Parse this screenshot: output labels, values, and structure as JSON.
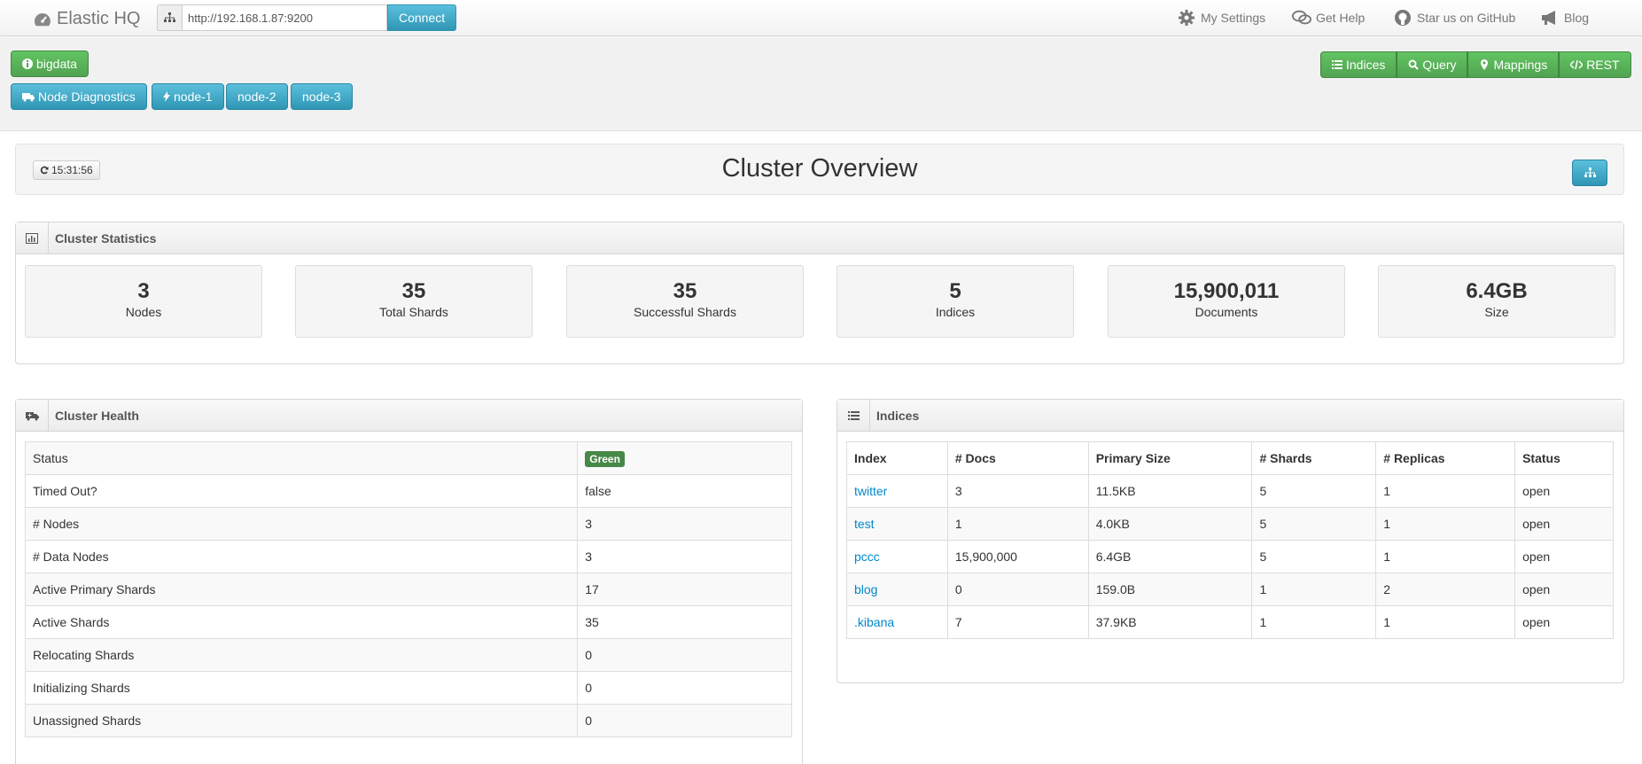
{
  "navbar": {
    "brand": "Elastic HQ",
    "url_value": "http://192.168.1.87:9200",
    "connect_label": "Connect",
    "links": [
      {
        "label": "My Settings",
        "icon": "gear-icon"
      },
      {
        "label": "Get Help",
        "icon": "comments-icon"
      },
      {
        "label": "Star us on GitHub",
        "icon": "github-icon"
      },
      {
        "label": "Blog",
        "icon": "bullhorn-icon"
      }
    ]
  },
  "toolbar": {
    "cluster_name": "bigdata",
    "node_diagnostics": "Node Diagnostics",
    "nodes": [
      "node-1",
      "node-2",
      "node-3"
    ],
    "right_buttons": [
      "Indices",
      "Query",
      "Mappings",
      "REST"
    ]
  },
  "overview": {
    "refresh_time": "15:31:56",
    "title": "Cluster Overview"
  },
  "stats": {
    "title": "Cluster Statistics",
    "items": [
      {
        "value": "3",
        "label": "Nodes"
      },
      {
        "value": "35",
        "label": "Total Shards"
      },
      {
        "value": "35",
        "label": "Successful Shards"
      },
      {
        "value": "5",
        "label": "Indices"
      },
      {
        "value": "15,900,011",
        "label": "Documents"
      },
      {
        "value": "6.4GB",
        "label": "Size"
      }
    ]
  },
  "health": {
    "title": "Cluster Health",
    "status_label": "Status",
    "status_value": "Green",
    "status_color": "#468847",
    "rows": [
      {
        "label": "Timed Out?",
        "value": "false"
      },
      {
        "label": "# Nodes",
        "value": "3"
      },
      {
        "label": "# Data Nodes",
        "value": "3"
      },
      {
        "label": "Active Primary Shards",
        "value": "17"
      },
      {
        "label": "Active Shards",
        "value": "35"
      },
      {
        "label": "Relocating Shards",
        "value": "0"
      },
      {
        "label": "Initializing Shards",
        "value": "0"
      },
      {
        "label": "Unassigned Shards",
        "value": "0"
      }
    ]
  },
  "indices": {
    "title": "Indices",
    "columns": [
      "Index",
      "# Docs",
      "Primary Size",
      "# Shards",
      "# Replicas",
      "Status"
    ],
    "rows": [
      [
        "twitter",
        "3",
        "11.5KB",
        "5",
        "1",
        "open"
      ],
      [
        "test",
        "1",
        "4.0KB",
        "5",
        "1",
        "open"
      ],
      [
        "pccc",
        "15,900,000",
        "6.4GB",
        "5",
        "1",
        "open"
      ],
      [
        "blog",
        "0",
        "159.0B",
        "1",
        "2",
        "open"
      ],
      [
        ".kibana",
        "7",
        "37.9KB",
        "1",
        "1",
        "open"
      ]
    ]
  }
}
